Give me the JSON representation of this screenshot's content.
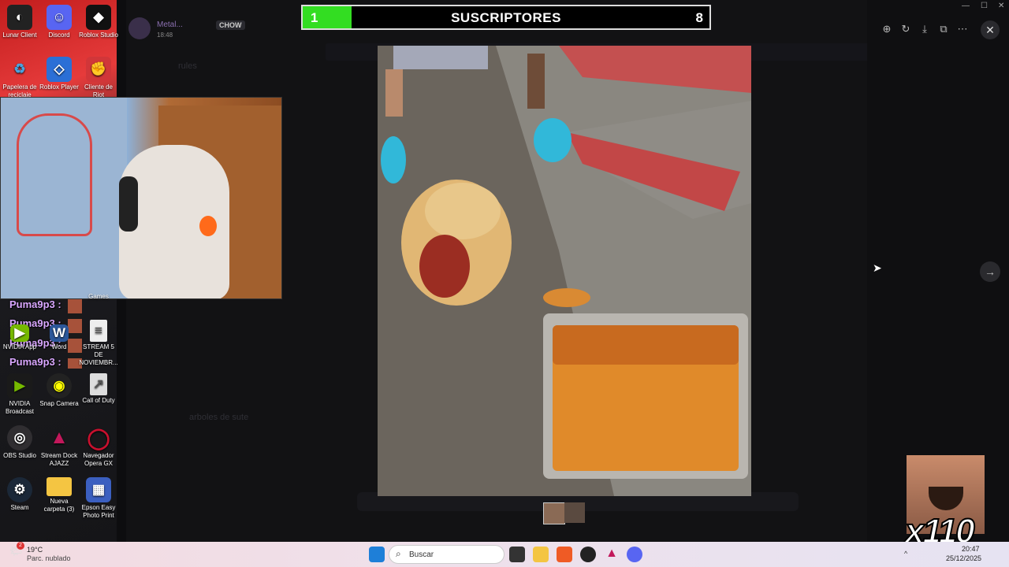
{
  "overlay": {
    "sub_left": "1",
    "sub_title": "SUSCRIPTORES",
    "sub_right": "8",
    "sub_progress": 0.12,
    "emote_text": "x110"
  },
  "discord": {
    "user_name": "Metal...",
    "user_tag": "CHOW",
    "user_time": "18:48",
    "channels": [
      "rules",
      "arboles de sute"
    ]
  },
  "viewer": {
    "thumb_count": 2
  },
  "desktop_icons": [
    {
      "label": "Lunar Client",
      "color": "#222"
    },
    {
      "label": "Discord",
      "color": "#5865f2"
    },
    {
      "label": "Roblox Studio",
      "color": "#111"
    },
    {
      "label": "Papelera de reciclaje",
      "color": "#4aa3df"
    },
    {
      "label": "Roblox Player",
      "color": "#2b6fd6"
    },
    {
      "label": "Cliente de Riot",
      "color": "#d13639"
    },
    {
      "label": "Games",
      "color": "#333"
    },
    {
      "label": "NVIDIA App",
      "color": "#76b900"
    },
    {
      "label": "Word",
      "color": "#2b579a"
    },
    {
      "label": "STREAM 5 DE NOVIEMBR...",
      "color": "#eee"
    },
    {
      "label": "NVIDIA Broadcast",
      "color": "#1a1a1a"
    },
    {
      "label": "Snap Camera",
      "color": "#222"
    },
    {
      "label": "Call of Duty",
      "color": "#ddd"
    },
    {
      "label": "OBS Studio",
      "color": "#302e31"
    },
    {
      "label": "Stream Dock AJAZZ",
      "color": "#c2185b"
    },
    {
      "label": "Navegador Opera GX",
      "color": "#c8102e"
    },
    {
      "label": "Steam",
      "color": "#1b2838"
    },
    {
      "label": "Nueva carpeta (3)",
      "color": "#f4c542"
    },
    {
      "label": "Epson Easy Photo Print",
      "color": "#3b5fc0"
    }
  ],
  "chat": [
    "Puma9p3 :",
    "Puma9p3 :",
    "Puma9p3 :",
    "Puma9p3 :"
  ],
  "taskbar": {
    "weather_temp": "19°C",
    "weather_desc": "Parc. nublado",
    "search_placeholder": "Buscar",
    "time": "20:47",
    "date": "25/12/2025",
    "weather_badge": "2"
  }
}
